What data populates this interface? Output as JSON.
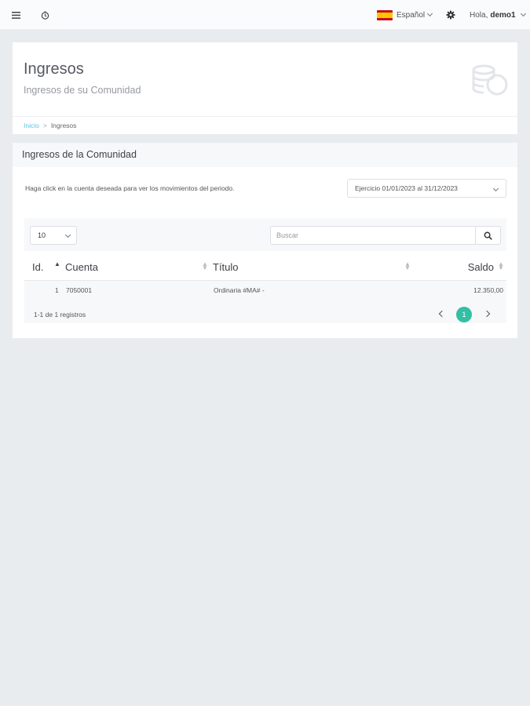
{
  "topbar": {
    "menu_icon": "hamburger-icon",
    "clock_icon": "clock-icon",
    "language": "Español",
    "settings_icon": "gear-icon",
    "greeting": "Hola,",
    "username": "demo1"
  },
  "header": {
    "title": "Ingresos",
    "subtitle": "Ingresos de su Comunidad",
    "icon": "coins-icon",
    "breadcrumb": {
      "home": "Inicio",
      "current": "Ingresos"
    }
  },
  "section": {
    "title": "Ingresos de la Comunidad",
    "hint": "Haga click en la cuenta deseada para ver los movimientos del periodo.",
    "period_selected": "Ejercicio 01/01/2023 al 31/12/2023"
  },
  "table": {
    "page_size": "10",
    "search_placeholder": "Buscar",
    "columns": [
      "Id.",
      "Cuenta",
      "Título",
      "Saldo"
    ],
    "rows": [
      {
        "id": "1",
        "cuenta": "7050001",
        "titulo": "Ordinaria #MA# -",
        "saldo": "12.350,00"
      }
    ],
    "info": "1-1 de 1 registros",
    "current_page": "1"
  },
  "colors": {
    "accent": "#34bfa3",
    "link": "#5bc4e1",
    "background": "#e9ecef"
  }
}
